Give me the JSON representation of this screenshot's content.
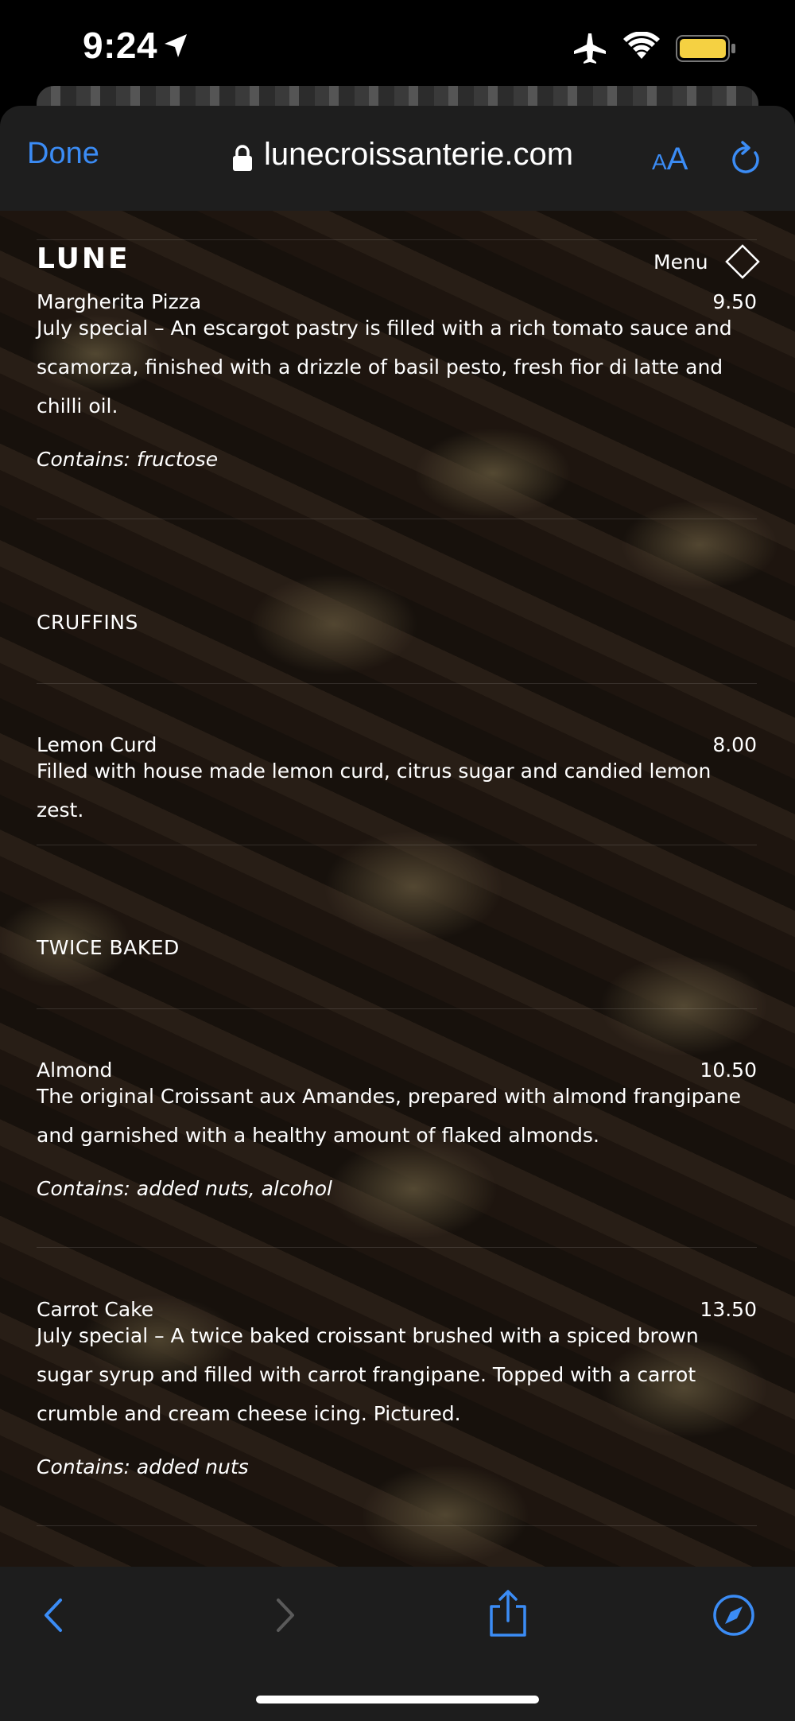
{
  "status_bar": {
    "time": "9:24"
  },
  "browser": {
    "done_label": "Done",
    "url": "lunecroissanterie.com",
    "text_size_small": "A",
    "text_size_large": "A"
  },
  "site": {
    "logo": "LUNE",
    "menu_label": "Menu"
  },
  "menu": {
    "margherita": {
      "name": "Margherita Pizza",
      "price": "9.50",
      "description": "July special – An escargot pastry is filled with a rich tomato sauce and scamorza, finished with a drizzle of basil pesto, fresh fior di latte and chilli oil.",
      "allergens": "Contains: fructose"
    },
    "section_cruffins": "CRUFFINS",
    "lemon_curd": {
      "name": "Lemon Curd",
      "price": "8.00",
      "description": "Filled with house made lemon curd, citrus sugar and candied lemon zest."
    },
    "section_twice_baked": "TWICE BAKED",
    "almond": {
      "name": "Almond",
      "price": "10.50",
      "description": "The original Croissant aux Amandes, prepared with almond frangipane and garnished with a healthy amount of flaked almonds.",
      "allergens": "Contains: added nuts, alcohol"
    },
    "carrot_cake": {
      "name": "Carrot Cake",
      "price": "13.50",
      "description": "July special – A twice baked croissant brushed with a spiced brown sugar syrup and filled with carrot frangipane. Topped with a carrot crumble and cream cheese icing. Pictured.",
      "allergens": "Contains: added nuts"
    }
  },
  "colors": {
    "accent": "#3b8cf5",
    "toolbar_bg": "#1e1e1e"
  },
  "icons": {
    "status": [
      "location-arrow-icon",
      "airplane-icon",
      "wifi-icon",
      "battery-icon"
    ],
    "toolbar": [
      "back-icon",
      "forward-icon",
      "share-icon",
      "compass-icon"
    ]
  }
}
